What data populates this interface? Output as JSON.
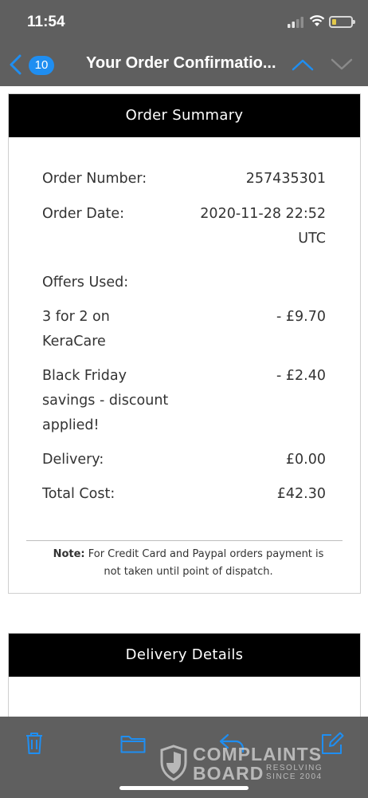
{
  "status": {
    "time": "11:54"
  },
  "nav": {
    "badge_count": "10",
    "title": "Your Order Confirmatio..."
  },
  "summary": {
    "header": "Order Summary",
    "order_number_label": "Order Number:",
    "order_number_value": "257435301",
    "order_date_label": "Order Date:",
    "order_date_value_line1": "2020-11-28 22:52",
    "order_date_value_line2": "UTC",
    "offers_label": "Offers Used:",
    "offer1_label_line1": "3 for 2 on",
    "offer1_label_line2": "KeraCare",
    "offer1_value": "- £9.70",
    "offer2_label_line1": "Black Friday",
    "offer2_label_line2": "savings - discount",
    "offer2_label_line3": "applied!",
    "offer2_value": "- £2.40",
    "delivery_label": "Delivery:",
    "delivery_value": "£0.00",
    "total_label": "Total Cost:",
    "total_value": "£42.30",
    "note_label": "Note:",
    "note_text_line1": " For Credit Card and Paypal orders payment is",
    "note_text_line2": "not taken until point of dispatch."
  },
  "delivery": {
    "header": "Delivery Details"
  },
  "watermark": {
    "line1": "COMPLAINTS",
    "line2": "BOARD",
    "tag1": "RESOLVING",
    "tag2": "SINCE 2004"
  },
  "colors": {
    "bar": "#5f5f5f",
    "accent": "#1f8ef1",
    "header": "#000000"
  },
  "icons": [
    "back-chevron-icon",
    "chevron-up-icon",
    "chevron-down-icon",
    "trash-icon",
    "folder-icon",
    "reply-icon",
    "compose-icon"
  ]
}
